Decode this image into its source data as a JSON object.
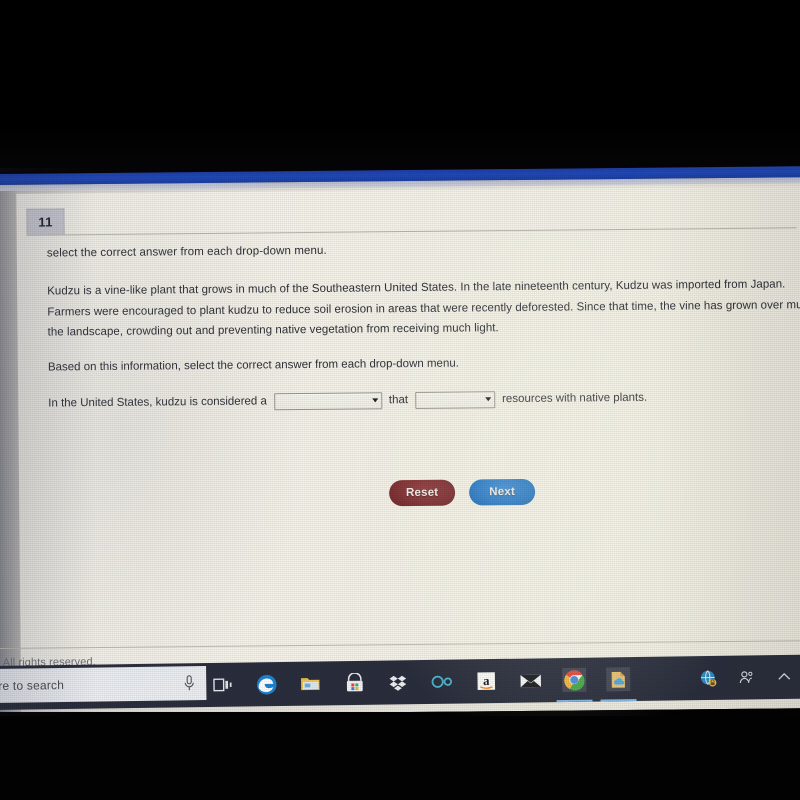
{
  "photo": {
    "description": "photo-of-laptop-screen"
  },
  "browser": {
    "chrome_bar_color": "#2149b8"
  },
  "question": {
    "number": "11",
    "instruction": "select the correct answer from each drop-down menu.",
    "passage_lines": [
      "Kudzu is a vine-like plant that grows in much of the Southeastern United States. In the late nineteenth century, Kudzu was imported from Japan.",
      "Farmers were encouraged to plant kudzu to reduce soil erosion in areas that were recently deforested. Since that time, the vine has grown over much of",
      "the landscape, crowding out and preventing native vegetation from receiving much light."
    ],
    "prompt": "Based on this information, select the correct answer from each drop-down menu.",
    "answer_sentence": {
      "lead": "In the United States, kudzu is considered a",
      "middle": "that",
      "tail": "resources with native plants."
    },
    "dropdowns": [
      {
        "name": "dropdown-1",
        "value": "",
        "arrow": "chevron-down-icon"
      },
      {
        "name": "dropdown-2",
        "value": "",
        "arrow": "chevron-down-icon"
      }
    ]
  },
  "buttons": {
    "reset": {
      "label": "Reset",
      "color": "#7d2b2e"
    },
    "next": {
      "label": "Next",
      "color": "#2176c7"
    }
  },
  "footer": {
    "text": "All rights reserved."
  },
  "taskbar": {
    "search": {
      "text": "re to search",
      "placeholder": "Type here to search",
      "mic_icon": "microphone-icon"
    },
    "icons": [
      {
        "name": "task-view-icon",
        "label": "Task View"
      },
      {
        "name": "edge-browser-icon",
        "label": "Microsoft Edge"
      },
      {
        "name": "file-explorer-icon",
        "label": "File Explorer"
      },
      {
        "name": "microsoft-store-icon",
        "label": "Microsoft Store"
      },
      {
        "name": "dropbox-icon",
        "label": "Dropbox"
      },
      {
        "name": "infinity-link-icon",
        "label": "Link"
      },
      {
        "name": "amazon-icon",
        "label": "Amazon"
      },
      {
        "name": "mail-icon",
        "label": "Mail"
      },
      {
        "name": "chrome-icon",
        "label": "Google Chrome"
      },
      {
        "name": "onedrive-doc-icon",
        "label": "Document"
      }
    ],
    "tray": [
      {
        "name": "network-globe-icon",
        "label": "Network"
      },
      {
        "name": "people-icon",
        "label": "People"
      },
      {
        "name": "show-hidden-icons-chevron-icon",
        "label": "Show hidden icons"
      }
    ]
  }
}
